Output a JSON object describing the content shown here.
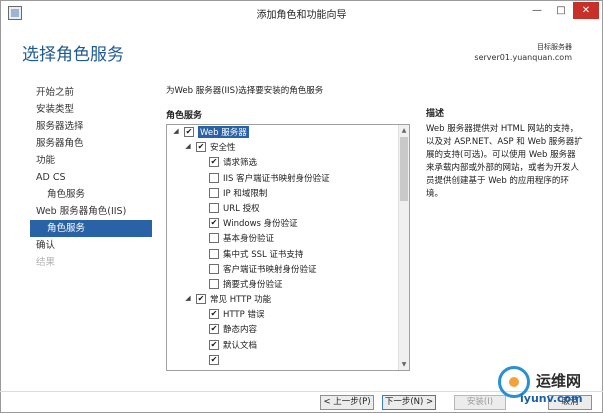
{
  "window": {
    "title": "添加角色和功能向导",
    "minimize": "—",
    "maximize": "□",
    "close": "✕"
  },
  "page": {
    "title": "选择角色服务",
    "destination_label": "目标服务器",
    "destination_server": "server01.yuanquan.com"
  },
  "nav": {
    "items": [
      {
        "label": "开始之前",
        "state": "normal"
      },
      {
        "label": "安装类型",
        "state": "normal"
      },
      {
        "label": "服务器选择",
        "state": "normal"
      },
      {
        "label": "服务器角色",
        "state": "normal"
      },
      {
        "label": "功能",
        "state": "normal"
      },
      {
        "label": "AD CS",
        "state": "normal"
      },
      {
        "label": "角色服务",
        "state": "sub"
      },
      {
        "label": "Web 服务器角色(IIS)",
        "state": "normal"
      },
      {
        "label": "角色服务",
        "state": "active"
      },
      {
        "label": "确认",
        "state": "normal"
      },
      {
        "label": "结果",
        "state": "disabled"
      }
    ]
  },
  "main": {
    "intro": "为Web 服务器(IIS)选择要安装的角色服务",
    "roles_header": "角色服务",
    "tree": [
      {
        "label": "Web 服务器",
        "level": 0,
        "expander": "◢",
        "checked": true,
        "selected": true
      },
      {
        "label": "安全性",
        "level": 1,
        "expander": "◢",
        "checked": true
      },
      {
        "label": "请求筛选",
        "level": 2,
        "checked": true
      },
      {
        "label": "IIS 客户端证书映射身份验证",
        "level": 2,
        "checked": false
      },
      {
        "label": "IP 和域限制",
        "level": 2,
        "checked": false
      },
      {
        "label": "URL 授权",
        "level": 2,
        "checked": false
      },
      {
        "label": "Windows 身份验证",
        "level": 2,
        "checked": true
      },
      {
        "label": "基本身份验证",
        "level": 2,
        "checked": false
      },
      {
        "label": "集中式 SSL 证书支持",
        "level": 2,
        "checked": false
      },
      {
        "label": "客户端证书映射身份验证",
        "level": 2,
        "checked": false
      },
      {
        "label": "摘要式身份验证",
        "level": 2,
        "checked": false
      },
      {
        "label": "常见 HTTP 功能",
        "level": 1,
        "expander": "◢",
        "checked": true
      },
      {
        "label": "HTTP 错误",
        "level": 2,
        "checked": true
      },
      {
        "label": "静态内容",
        "level": 2,
        "checked": true
      },
      {
        "label": "默认文档",
        "level": 2,
        "checked": true
      },
      {
        "label": "",
        "level": 2,
        "checked": true
      }
    ],
    "check_mark": "✔",
    "scroll_up": "▲",
    "scroll_down": "▼"
  },
  "description": {
    "header": "描述",
    "text": "Web 服务器提供对 HTML 网站的支持，以及对 ASP.NET、ASP 和 Web 服务器扩展的支持(可选)。可以使用 Web 服务器来承载内部或外部的网站，或者为开发人员提供创建基于 Web 的应用程序的环境。"
  },
  "footer": {
    "prev": "< 上一步(P)",
    "next": "下一步(N) >",
    "install": "安装(I)",
    "cancel": "取消"
  },
  "watermark": {
    "name": "运维网",
    "url": "iyunv.com"
  }
}
